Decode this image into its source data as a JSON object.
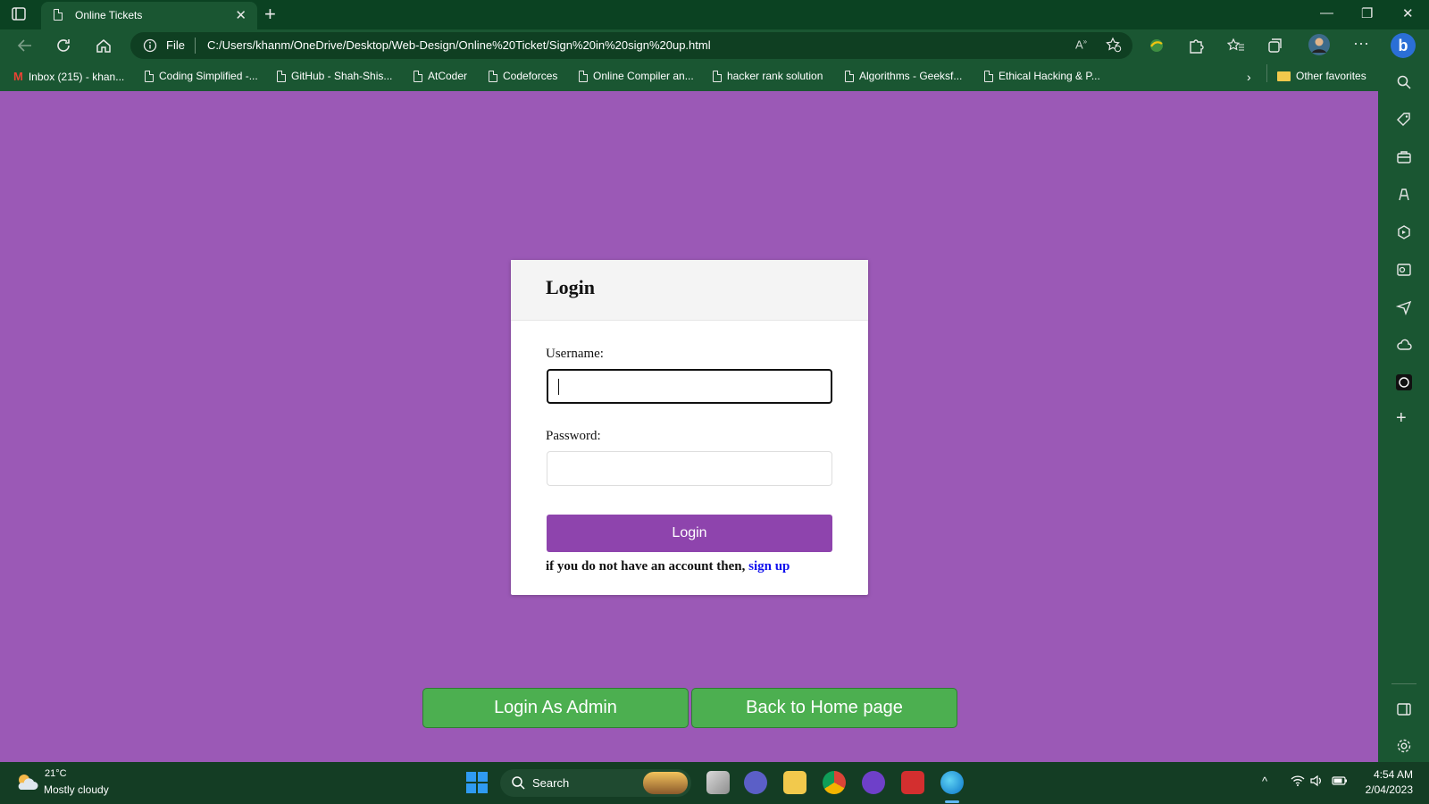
{
  "browser": {
    "tab_title": "Online Tickets",
    "address": {
      "scheme_label": "File",
      "url": "C:/Users/khanm/OneDrive/Desktop/Web-Design/Online%20Ticket/Sign%20in%20sign%20up.html"
    },
    "favorites": [
      {
        "label": "Inbox (215) - khan...",
        "icon": "gmail-icon"
      },
      {
        "label": "Coding Simplified -...",
        "icon": "document-icon"
      },
      {
        "label": "GitHub - Shah-Shis...",
        "icon": "document-icon"
      },
      {
        "label": "AtCoder",
        "icon": "document-icon"
      },
      {
        "label": "Codeforces",
        "icon": "document-icon"
      },
      {
        "label": "Online Compiler an...",
        "icon": "document-icon"
      },
      {
        "label": "hacker rank solution",
        "icon": "document-icon"
      },
      {
        "label": "Algorithms - Geeksf...",
        "icon": "document-icon"
      },
      {
        "label": "Ethical Hacking & P...",
        "icon": "document-icon"
      }
    ],
    "other_favorites": "Other favorites"
  },
  "login_card": {
    "title": "Login",
    "username_label": "Username:",
    "username_value": "",
    "password_label": "Password:",
    "password_value": "",
    "login_button": "Login",
    "signup_prompt": "if you do not have an account then, ",
    "signup_link": "sign up"
  },
  "page_buttons": {
    "admin": "Login As Admin",
    "home": "Back to Home page"
  },
  "taskbar": {
    "weather_temp": "21°C",
    "weather_desc": "Mostly cloudy",
    "search_label": "Search",
    "time": "4:54 AM",
    "date": "2/04/2023"
  },
  "colors": {
    "page_background": "#9b59b6",
    "login_button": "#8e44ad",
    "green_buttons": "#4caf50",
    "browser_chrome": "#1a5632",
    "link": "#1010ee"
  }
}
